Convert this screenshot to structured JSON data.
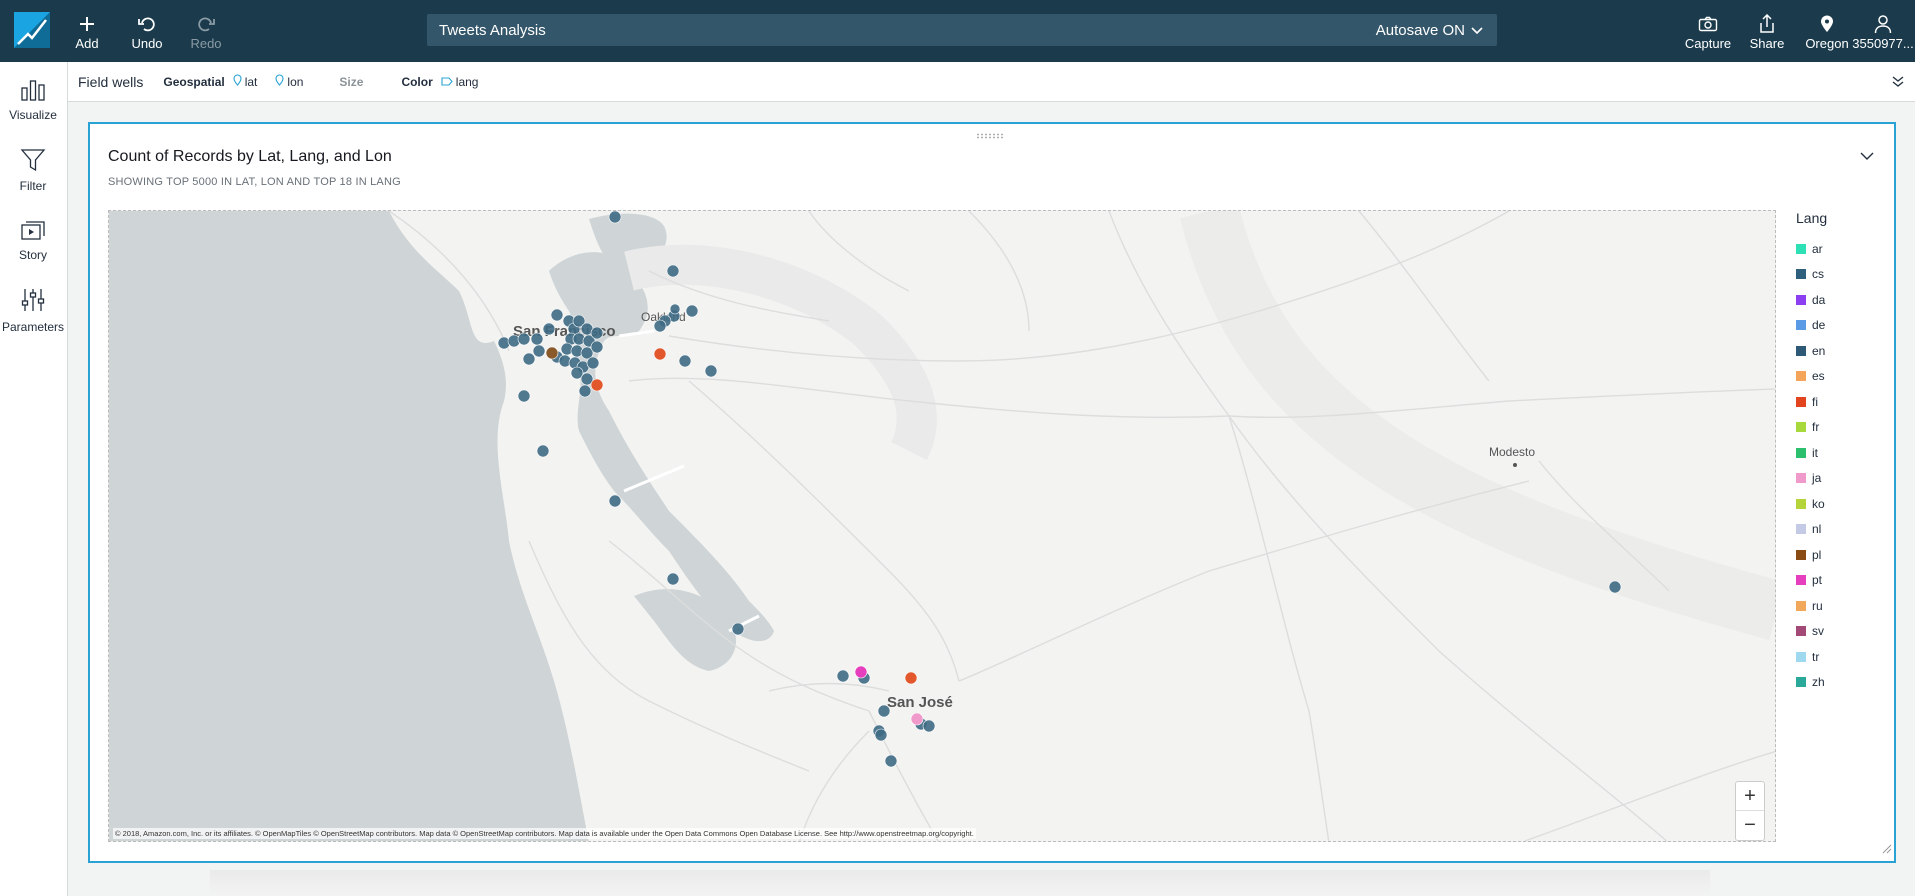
{
  "app": {
    "title": "Tweets Analysis",
    "autosave": "Autosave ON"
  },
  "toolbar": {
    "add": "Add",
    "undo": "Undo",
    "redo": "Redo",
    "capture": "Capture",
    "share": "Share",
    "region": "Oregon",
    "account": "3550977..."
  },
  "sidebar": {
    "items": [
      {
        "label": "Visualize",
        "icon": "bar-chart-icon"
      },
      {
        "label": "Filter",
        "icon": "funnel-icon"
      },
      {
        "label": "Story",
        "icon": "story-icon"
      },
      {
        "label": "Parameters",
        "icon": "sliders-icon"
      }
    ]
  },
  "fieldwells": {
    "label": "Field wells",
    "geospatial": "Geospatial",
    "lat": "lat",
    "lon": "lon",
    "size": "Size",
    "color": "Color",
    "lang": "lang"
  },
  "visual": {
    "title": "Count of Records by Lat, Lang, and Lon",
    "subtitle": "SHOWING TOP 5000 IN LAT, LON AND TOP 18 IN LANG",
    "map_labels": {
      "sf": "San Francisco",
      "oakland": "Oakland",
      "sanjose": "San José",
      "modesto": "Modesto"
    },
    "attribution": "© 2018, Amazon.com, Inc. or its affiliates. © OpenMapTiles © OpenStreetMap contributors. Map data © OpenStreetMap contributors. Map data is available under the Open Data Commons Open Database License. See http://www.openstreetmap.org/copyright.",
    "zoom_in": "+",
    "zoom_out": "−"
  },
  "legend": {
    "title": "Lang",
    "items": [
      {
        "label": "ar",
        "color": "#2ee0b5"
      },
      {
        "label": "cs",
        "color": "#2e5f7d"
      },
      {
        "label": "da",
        "color": "#8b3ff0"
      },
      {
        "label": "de",
        "color": "#5b9be6"
      },
      {
        "label": "en",
        "color": "#2d5876"
      },
      {
        "label": "es",
        "color": "#f5a55a"
      },
      {
        "label": "fi",
        "color": "#e2451e"
      },
      {
        "label": "fr",
        "color": "#a8d93c"
      },
      {
        "label": "it",
        "color": "#2bbf6e"
      },
      {
        "label": "ja",
        "color": "#f09acb"
      },
      {
        "label": "ko",
        "color": "#b4d43a"
      },
      {
        "label": "nl",
        "color": "#c4c9e6"
      },
      {
        "label": "pl",
        "color": "#8a4b14"
      },
      {
        "label": "pt",
        "color": "#e53fbd"
      },
      {
        "label": "ru",
        "color": "#f2a85a"
      },
      {
        "label": "sv",
        "color": "#a24a75"
      },
      {
        "label": "tr",
        "color": "#9fd9ef"
      },
      {
        "label": "zh",
        "color": "#2aa89a"
      }
    ]
  },
  "points_color": "#3e6a84"
}
